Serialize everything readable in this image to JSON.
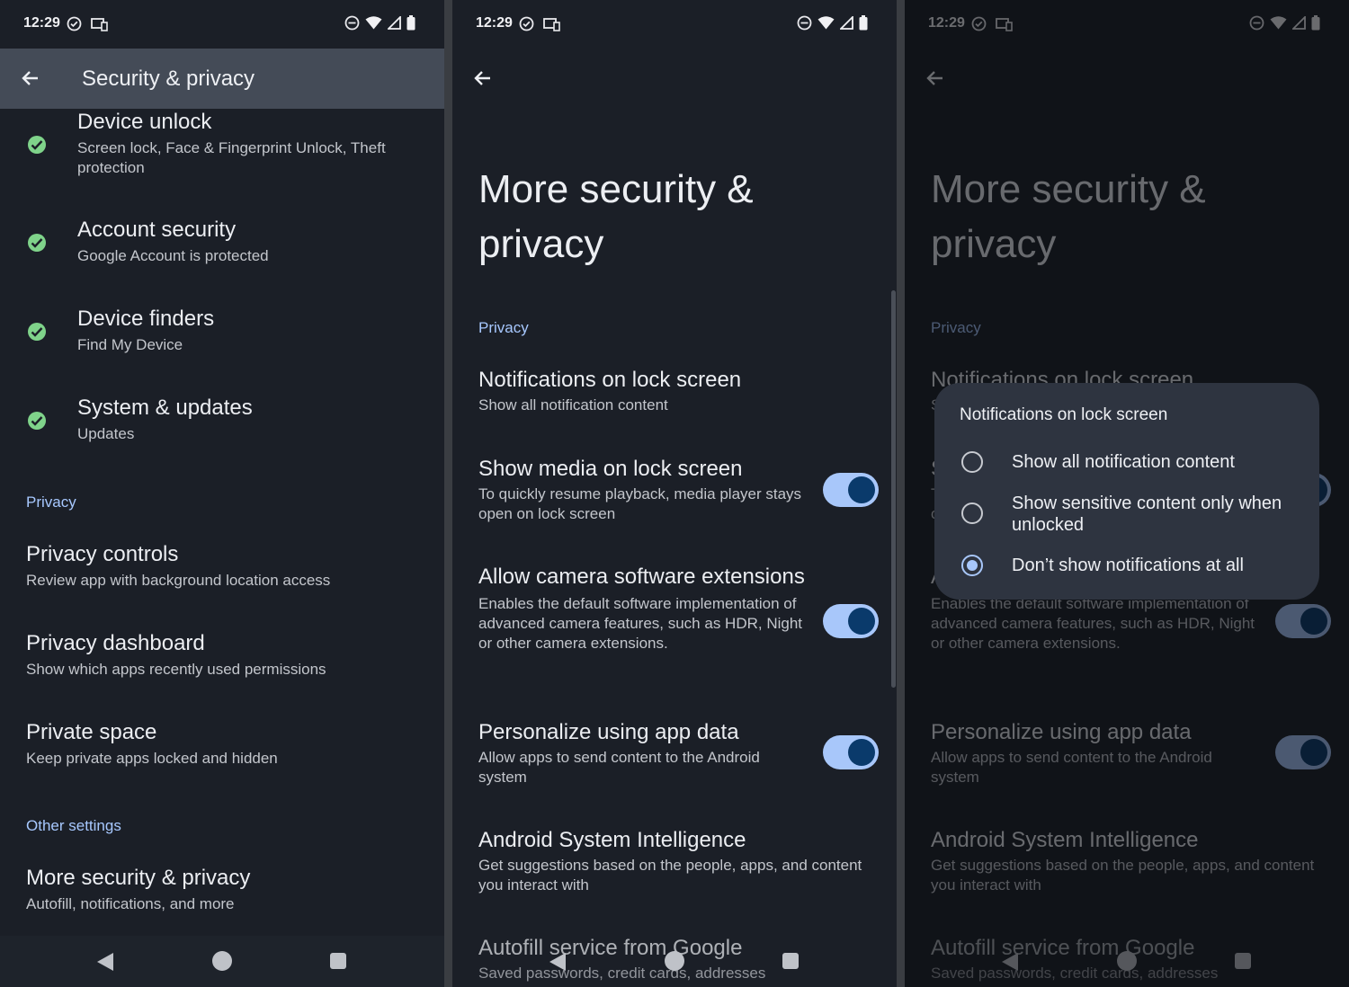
{
  "status": {
    "time": "12:29"
  },
  "panel1": {
    "header_title": "Security & privacy",
    "items": [
      {
        "title": "Device unlock",
        "subtitle": "Screen lock, Face & Fingerprint Unlock, Theft protection"
      },
      {
        "title": "Account security",
        "subtitle": "Google Account is protected"
      },
      {
        "title": "Device finders",
        "subtitle": "Find My Device"
      },
      {
        "title": "System & updates",
        "subtitle": "Updates"
      }
    ],
    "privacy_header": "Privacy",
    "privacy_items": [
      {
        "title": "Privacy controls",
        "subtitle": "Review app with background location access"
      },
      {
        "title": "Privacy dashboard",
        "subtitle": "Show which apps recently used permissions"
      },
      {
        "title": "Private space",
        "subtitle": "Keep private apps locked and hidden"
      }
    ],
    "other_header": "Other settings",
    "other_items": [
      {
        "title": "More security & privacy",
        "subtitle": "Autofill, notifications, and more"
      }
    ]
  },
  "more": {
    "title": "More security & privacy",
    "privacy_header": "Privacy",
    "rows": [
      {
        "title": "Notifications on lock screen",
        "subtitle": "Show all notification content"
      },
      {
        "title": "Show media on lock screen",
        "subtitle": "To quickly resume playback, media player stays open on lock screen",
        "on": true
      },
      {
        "title": "Allow camera software extensions",
        "subtitle": "Enables the default software implementation of advanced camera features, such as HDR, Night or other camera extensions.",
        "on": true
      },
      {
        "title": "Personalize using app data",
        "subtitle": "Allow apps to send content to the Android system",
        "on": true
      },
      {
        "title": "Android System Intelligence",
        "subtitle": "Get suggestions based on the people, apps, and content you interact with"
      },
      {
        "title": "Autofill service from Google",
        "subtitle": "Saved passwords, credit cards, addresses"
      }
    ]
  },
  "dialog": {
    "title": "Notifications on lock screen",
    "options": [
      {
        "label": "Show all notification content",
        "selected": false
      },
      {
        "label": "Show sensitive content only when unlocked",
        "selected": false
      },
      {
        "label": "Don’t show notifications at all",
        "selected": true
      }
    ]
  },
  "colors": {
    "accent": "#a8c7fa",
    "check": "#7fd38a",
    "background": "#1b1f27",
    "header": "#444b57"
  },
  "icons": [
    "back-arrow-icon",
    "check-icon",
    "wifi-icon",
    "signal-icon",
    "battery-icon",
    "dnd-icon",
    "nav-back-icon",
    "nav-home-icon",
    "nav-recents-icon"
  ]
}
